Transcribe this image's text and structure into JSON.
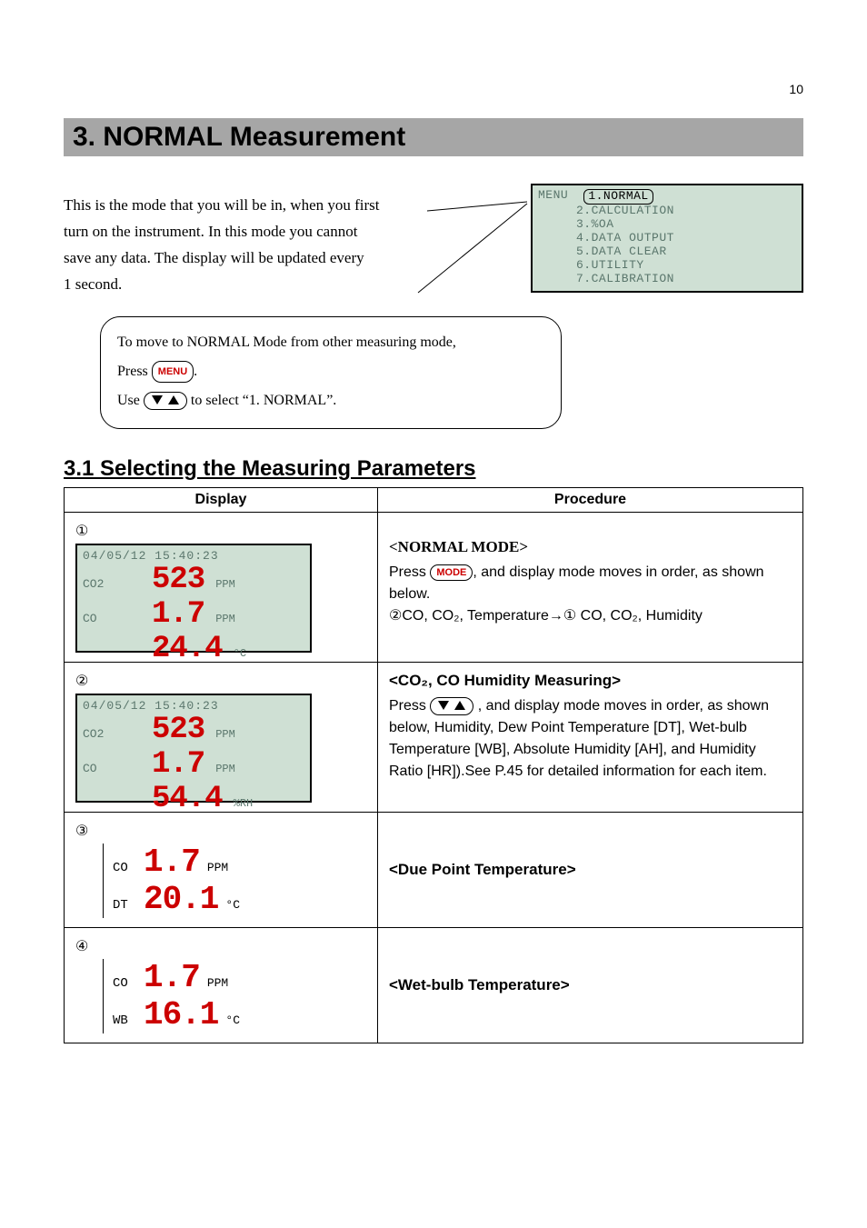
{
  "page_number": "10",
  "heading": "3. NORMAL Measurement",
  "intro": [
    "This is the mode that you will be in, when you first",
    "turn on the instrument.    In this mode you cannot",
    "save any data.    The display will be updated every",
    "1 second."
  ],
  "menu_label": "MENU",
  "menu_items": [
    "1.NORMAL",
    "2.CALCULATION",
    "3.%OA",
    "4.DATA OUTPUT",
    "5.DATA CLEAR",
    "6.UTILITY",
    "7.CALIBRATION"
  ],
  "callout": {
    "line1": "To move to NORMAL Mode from other measuring mode,",
    "line2a": "Press ",
    "menu_btn": "MENU",
    "line2b": ".",
    "line3a": "Use ",
    "line3b": "  to select  “1. NORMAL”."
  },
  "subsection": "3.1 Selecting the Measuring Parameters",
  "table": {
    "headers": [
      "Display",
      "Procedure"
    ],
    "rows": [
      {
        "num": "①",
        "lcd": {
          "type": "green",
          "timestamp": "04/05/12 15:40:23",
          "lines": [
            {
              "label": "CO2",
              "value": "523",
              "unit": "PPM"
            },
            {
              "label": "CO",
              "value": "1.7",
              "unit": "PPM"
            },
            {
              "label": "",
              "value": "24.4",
              "unit": "°C"
            }
          ]
        },
        "proc_title": "<NORMAL MODE>",
        "proc_lines_pre": "Press ",
        "mode_btn": "MODE",
        "proc_lines_post": ", and display mode moves in order, as shown below.",
        "cycle": "②CO, CO₂, Temperature→①  CO, CO₂, Humidity"
      },
      {
        "num": "②",
        "lcd": {
          "type": "green",
          "timestamp": "04/05/12 15:40:23",
          "lines": [
            {
              "label": "CO2",
              "value": "523",
              "unit": "PPM"
            },
            {
              "label": "CO",
              "value": "1.7",
              "unit": "PPM"
            },
            {
              "label": "",
              "value": "54.4",
              "unit": "%RH"
            }
          ]
        },
        "proc_title": "<CO₂, CO Humidity Measuring>",
        "proc_lines_pre": "Press ",
        "proc_lines_post": " , and display mode moves in order, as shown below, Humidity, Dew Point Temperature [DT], Wet-bulb Temperature [WB], Absolute Humidity [AH], and Humidity Ratio [HR]).See P.45 for detailed information for each item."
      },
      {
        "num": "③",
        "lcd": {
          "type": "bw",
          "lines": [
            {
              "label": "CO",
              "value": "1.7",
              "unit": "PPM"
            },
            {
              "label": "DT",
              "value": "20.1",
              "unit": "°C"
            }
          ]
        },
        "proc_title": "<Due Point Temperature>"
      },
      {
        "num": "④",
        "lcd": {
          "type": "bw",
          "lines": [
            {
              "label": "CO",
              "value": "1.7",
              "unit": "PPM"
            },
            {
              "label": "WB",
              "value": "16.1",
              "unit": "°C"
            }
          ]
        },
        "proc_title": "<Wet-bulb Temperature>"
      }
    ]
  }
}
